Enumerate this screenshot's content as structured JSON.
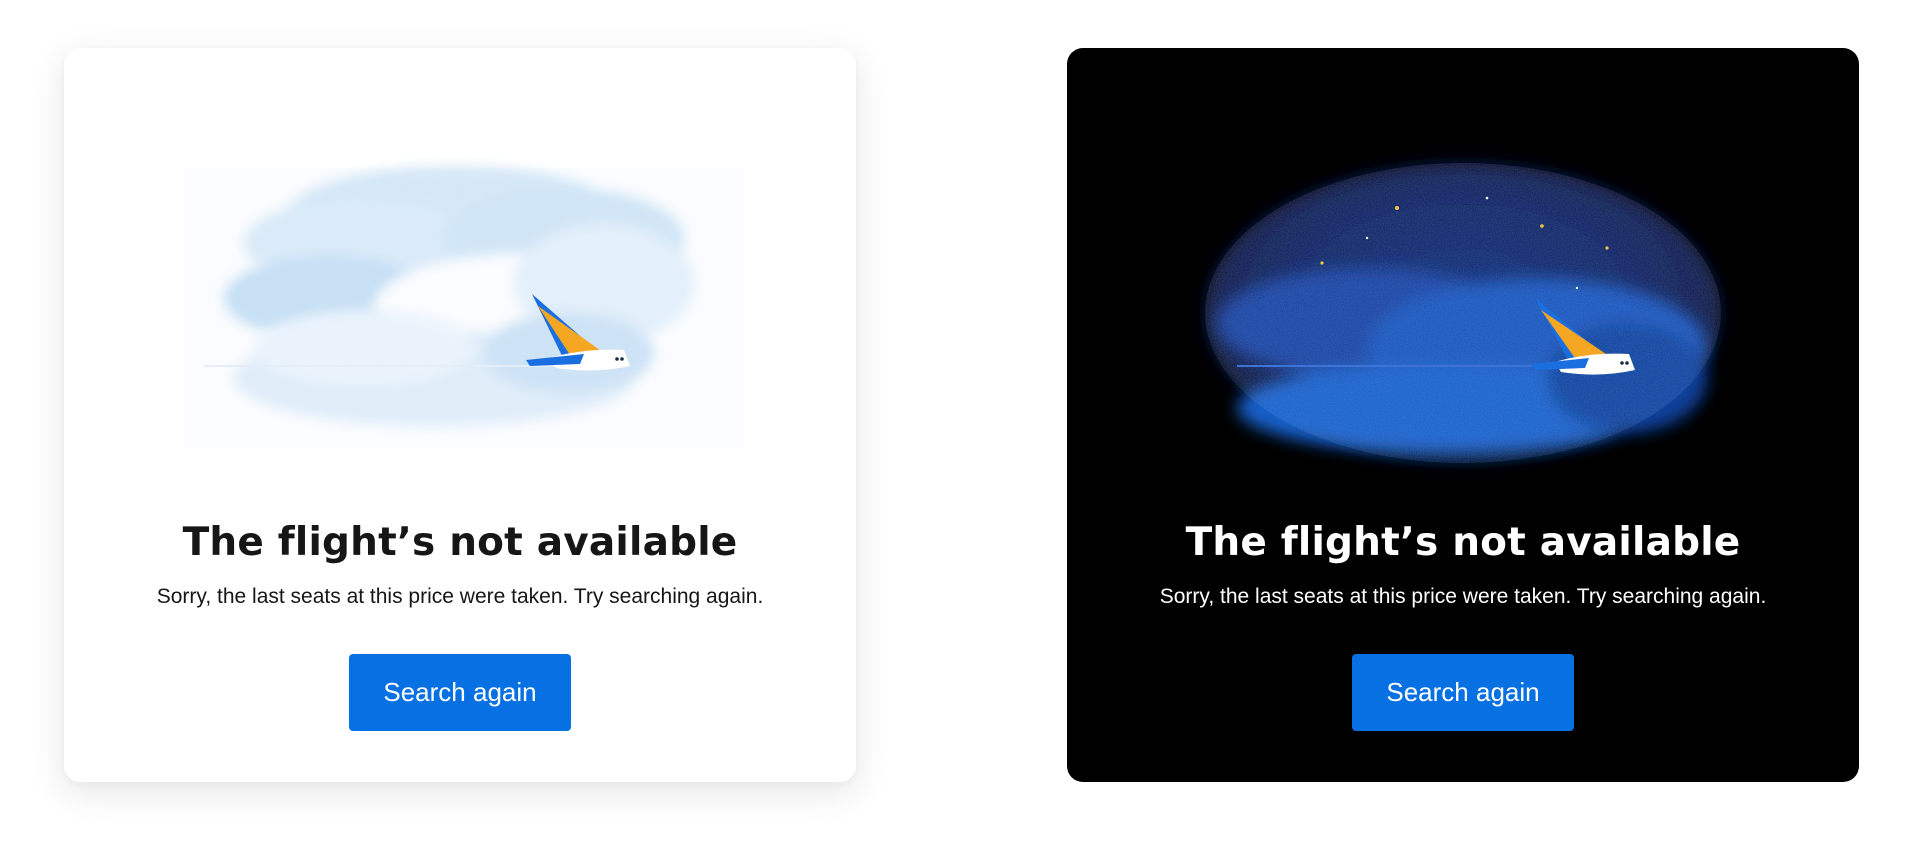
{
  "colors": {
    "button": "#0770e3",
    "light_card": "#ffffff",
    "dark_card": "#000000",
    "plane_tail_blue": "#1a6fe0",
    "plane_tail_orange": "#f5a623"
  },
  "cards": [
    {
      "theme": "light",
      "illustration": "plane-in-clouds-day",
      "title": "The flight’s not available",
      "message": "Sorry, the last seats at this price were taken. Try searching again.",
      "button_label": "Search again"
    },
    {
      "theme": "dark",
      "illustration": "plane-in-clouds-night",
      "title": "The flight’s not available",
      "message": "Sorry, the last seats at this price were taken. Try searching again.",
      "button_label": "Search again"
    }
  ]
}
